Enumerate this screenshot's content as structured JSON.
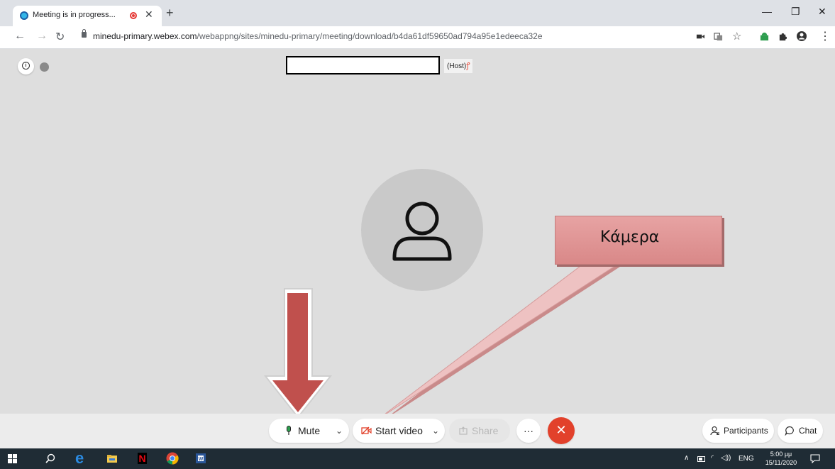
{
  "browser": {
    "tab_title": "Meeting is in progress...",
    "url_host": "minedu-primary.webex.com",
    "url_path": "/webappng/sites/minedu-primary/meeting/download/b4da61df59650ad794a95e1edeeca32e"
  },
  "meeting": {
    "host_label": "(Host)"
  },
  "annotation": {
    "label": "Κάμερα"
  },
  "controls": {
    "mute_label": "Mute",
    "video_label": "Start video",
    "share_label": "Share",
    "more_label": "···",
    "participants_label": "Participants",
    "chat_label": "Chat"
  },
  "taskbar": {
    "lang": "ENG",
    "time": "5:00 μμ",
    "date": "15/11/2020"
  },
  "colors": {
    "leave": "#e2412b",
    "callout": "#d98888",
    "arrow": "#c0504d"
  }
}
